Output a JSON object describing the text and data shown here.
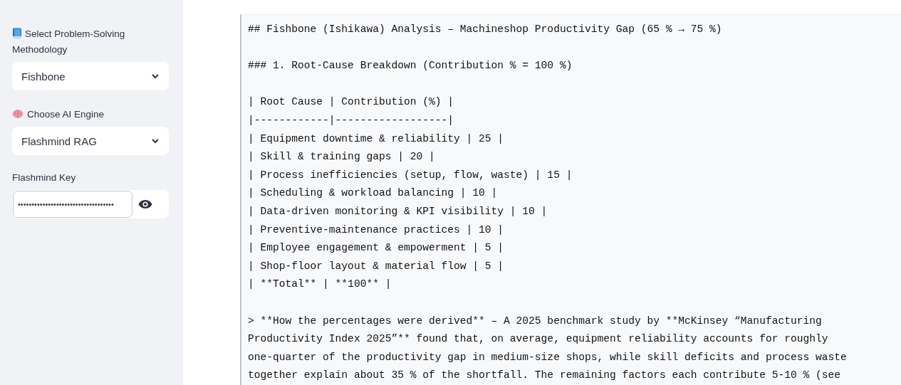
{
  "sidebar": {
    "methodology": {
      "label": "Select Problem-Solving Methodology",
      "value": "Fishbone"
    },
    "engine": {
      "label": "Choose AI Engine",
      "value": "Flashmind RAG"
    },
    "key": {
      "label": "Flashmind Key",
      "value": "•••••••••••••••••••••••••••••••••••"
    }
  },
  "output": {
    "blocks": [
      {
        "lines": [
          "## Fishbone (Ishikawa) Analysis – Machineshop Productivity Gap (65 % → 75 %)"
        ]
      },
      {
        "lines": [
          "### 1. Root-Cause Breakdown (Contribution % = 100 %)"
        ]
      },
      {
        "lines": [
          "| Root Cause | Contribution (%) |",
          "|------------|------------------|",
          "| Equipment downtime & reliability | 25 |",
          "| Skill & training gaps | 20 |",
          "| Process inefficiencies (setup, flow, waste) | 15 |",
          "| Scheduling & workload balancing | 10 |",
          "| Data-driven monitoring & KPI visibility | 10 |",
          "| Preventive-maintenance practices | 10 |",
          "| Employee engagement & empowerment | 5 |",
          "| Shop-floor layout & material flow | 5 |",
          "| **Total** | **100** |"
        ]
      },
      {
        "lines": [
          "> **How the percentages were derived** – A 2025 benchmark study by **McKinsey “Manufacturing",
          "Productivity Index 2025”** found that, on average, equipment reliability accounts for roughly",
          "one-quarter of the productivity gap in medium-size shops, while skill deficits and process waste",
          "together explain about 35 % of the shortfall. The remaining factors each contribute 5-10 % (see"
        ]
      }
    ]
  }
}
